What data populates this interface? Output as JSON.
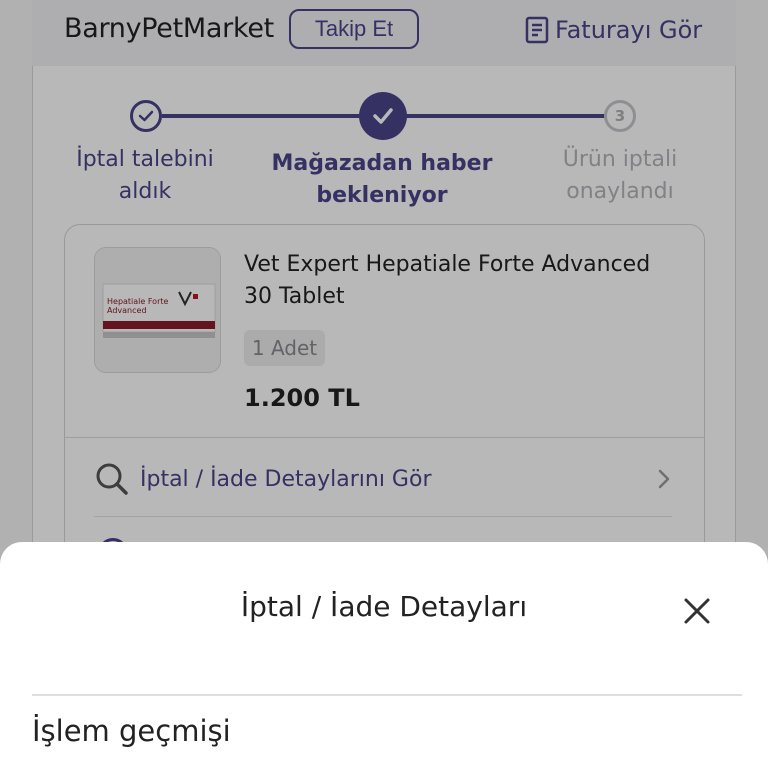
{
  "store": {
    "name": "BarnyPetMarket",
    "follow_label": "Takip Et",
    "invoice_label": "Faturayı Gör"
  },
  "stepper": {
    "steps": [
      {
        "label_line1": "İptal talebini",
        "label_line2": "aldık",
        "state": "done"
      },
      {
        "label_line1": "Mağazadan haber",
        "label_line2": "bekleniyor",
        "state": "current"
      },
      {
        "label_line1": "Ürün iptali",
        "label_line2": "onaylandı",
        "state": "pending",
        "number": "3"
      }
    ]
  },
  "product": {
    "title": "Vet Expert Hepatiale Forte Advanced 30 Tablet",
    "quantity": "1 Adet",
    "price": "1.200 TL",
    "thumb_text_line1": "Hepatiale Forte",
    "thumb_text_line2": "Advanced"
  },
  "details_row": {
    "label": "İptal / İade Detaylarını Gör"
  },
  "sheet": {
    "title": "İptal / İade Detayları",
    "section_heading": "İşlem geçmişi"
  },
  "colors": {
    "accent": "#4b4589",
    "pending": "#c7c7cc",
    "text": "#222222"
  }
}
